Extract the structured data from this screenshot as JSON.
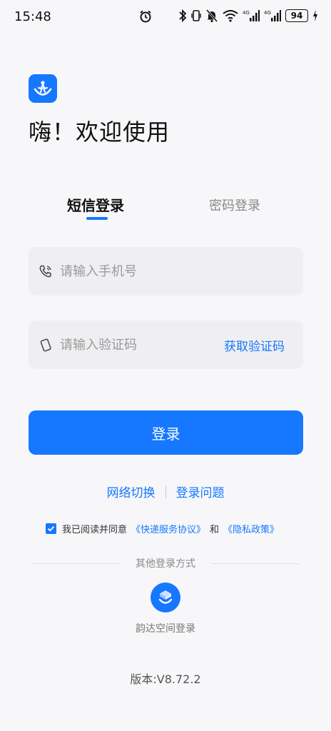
{
  "status_bar": {
    "time": "15:48",
    "battery": "94"
  },
  "greeting": "嗨！欢迎使用",
  "tabs": {
    "sms": "短信登录",
    "password": "密码登录"
  },
  "phone_field": {
    "placeholder": "请输入手机号"
  },
  "code_field": {
    "placeholder": "请输入验证码",
    "get_code": "获取验证码"
  },
  "login_button": "登录",
  "links": {
    "network_switch": "网络切换",
    "login_problem": "登录问题"
  },
  "agreement": {
    "prefix": "我已阅读并同意",
    "service": "《快递服务协议》",
    "and": "和",
    "privacy": "《隐私政策》",
    "checked": true
  },
  "other_login": {
    "title": "其他登录方式",
    "yunda_space": "韵达空间登录"
  },
  "version": "版本:V8.72.2",
  "colors": {
    "accent": "#1677ff",
    "background": "#f7f7f9",
    "field_bg": "#efeff2"
  },
  "icons": [
    "alarm-icon",
    "bluetooth-icon",
    "vibrate-icon",
    "mute-icon",
    "wifi-icon",
    "signal-icon",
    "battery-icon",
    "charging-icon",
    "app-logo-icon",
    "phone-icon",
    "phone-device-icon",
    "check-icon",
    "yunda-space-icon"
  ]
}
